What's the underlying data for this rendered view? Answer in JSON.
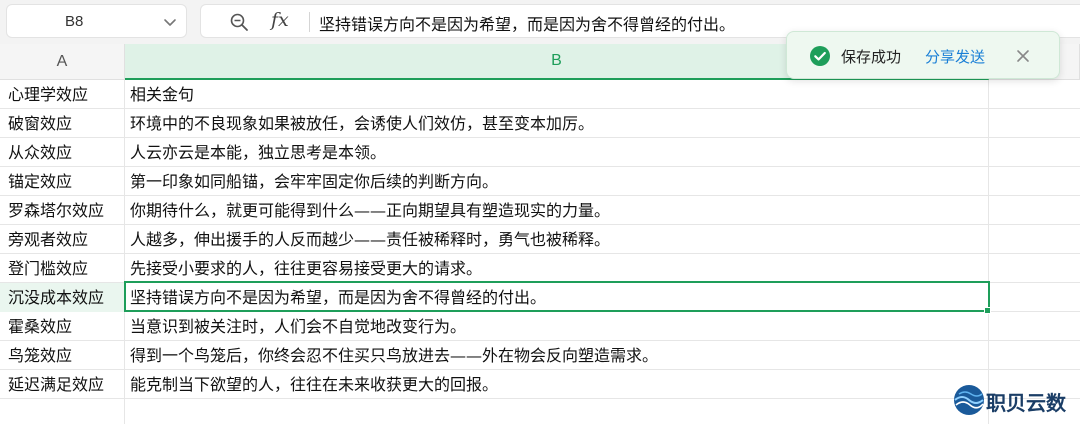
{
  "formula_bar": {
    "cell_ref": "B8",
    "fx_label": "fx",
    "content": "坚持错误方向不是因为希望，而是因为舍不得曾经的付出。"
  },
  "columns": [
    "A",
    "B",
    ""
  ],
  "rows": [
    {
      "a": "心理学效应",
      "b": "相关金句"
    },
    {
      "a": "破窗效应",
      "b": "环境中的不良现象如果被放任，会诱使人们效仿，甚至变本加厉。"
    },
    {
      "a": "从众效应",
      "b": "人云亦云是本能，独立思考是本领。"
    },
    {
      "a": "锚定效应",
      "b": "第一印象如同船锚，会牢牢固定你后续的判断方向。"
    },
    {
      "a": "罗森塔尔效应",
      "b": "你期待什么，就更可能得到什么——正向期望具有塑造现实的力量。"
    },
    {
      "a": "旁观者效应",
      "b": "人越多，伸出援手的人反而越少——责任被稀释时，勇气也被稀释。"
    },
    {
      "a": "登门槛效应",
      "b": "先接受小要求的人，往往更容易接受更大的请求。"
    },
    {
      "a": "沉没成本效应",
      "b": "坚持错误方向不是因为希望，而是因为舍不得曾经的付出。"
    },
    {
      "a": "霍桑效应",
      "b": "当意识到被关注时，人们会不自觉地改变行为。"
    },
    {
      "a": "鸟笼效应",
      "b": "得到一个鸟笼后，你终会忍不住买只鸟放进去——外在物会反向塑造需求。"
    },
    {
      "a": "延迟满足效应",
      "b": "能克制当下欲望的人，往往在未来收获更大的回报。"
    }
  ],
  "selected_row_index": 7,
  "toast": {
    "message": "保存成功",
    "action": "分享发送"
  },
  "watermark": {
    "text": "职贝云数"
  },
  "colors": {
    "accent_green": "#1e9e5a",
    "link_blue": "#1a7fd6"
  }
}
